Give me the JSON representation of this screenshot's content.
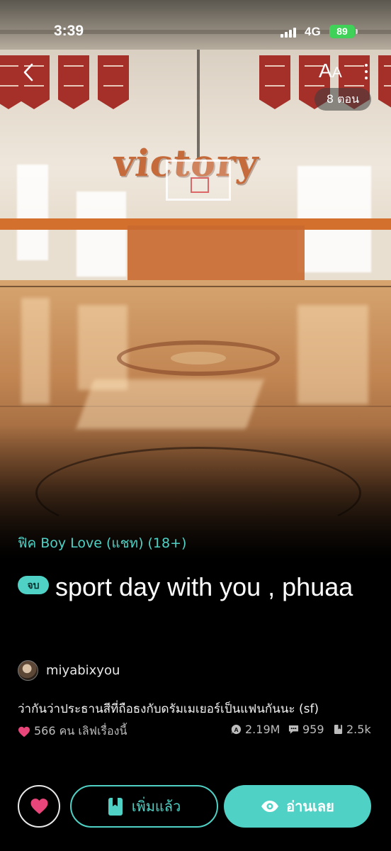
{
  "status_bar": {
    "time": "3:39",
    "network": "4G",
    "battery": "89"
  },
  "top_nav": {
    "font_size_label": "A",
    "font_size_label_small": "A",
    "chapters": "8 ตอน"
  },
  "cover": {
    "wall_text": "victory"
  },
  "story": {
    "category": "ฟิค Boy Love (แชท) (18+)",
    "status_badge": "จบ",
    "title": "sport day with you , phuaa",
    "author": "miyabixyou",
    "description": "ว่ากันว่าประธานสีที่ถือธงกับดรัมเมเยอร์เป็นแฟนกันนะ (sf)"
  },
  "stats": {
    "likes": "566 คน เลิฟเรื่องนี้",
    "views": "2.19M",
    "comments": "959",
    "bookmarks": "2.5k"
  },
  "actions": {
    "added_label": "เพิ่มแล้ว",
    "read_label": "อ่านเลย"
  },
  "colors": {
    "accent": "#4fd1c5",
    "heart": "#e8457a",
    "battery": "#3fd158"
  }
}
